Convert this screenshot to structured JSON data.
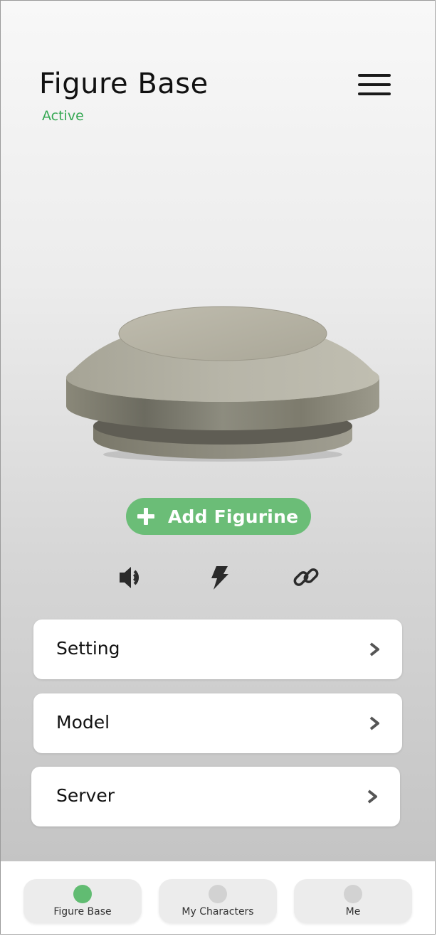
{
  "header": {
    "title": "Figure Base",
    "status": "Active",
    "status_color": "#35a853",
    "menu_icon": "hamburger-menu-icon"
  },
  "device": {
    "image": "figure-base-device-image"
  },
  "add_button": {
    "label": "Add Figurine",
    "icon": "plus-icon",
    "color": "#6bbd77"
  },
  "quick_actions": [
    {
      "icon": "speaker-icon"
    },
    {
      "icon": "lightning-icon"
    },
    {
      "icon": "link-icon"
    }
  ],
  "menu": {
    "items": [
      {
        "label": "Setting"
      },
      {
        "label": "Model"
      },
      {
        "label": "Server"
      }
    ]
  },
  "tabbar": {
    "tabs": [
      {
        "label": "Figure Base",
        "active": true
      },
      {
        "label": "My Characters",
        "active": false
      },
      {
        "label": "Me",
        "active": false
      }
    ],
    "active_color": "#61bc72"
  }
}
